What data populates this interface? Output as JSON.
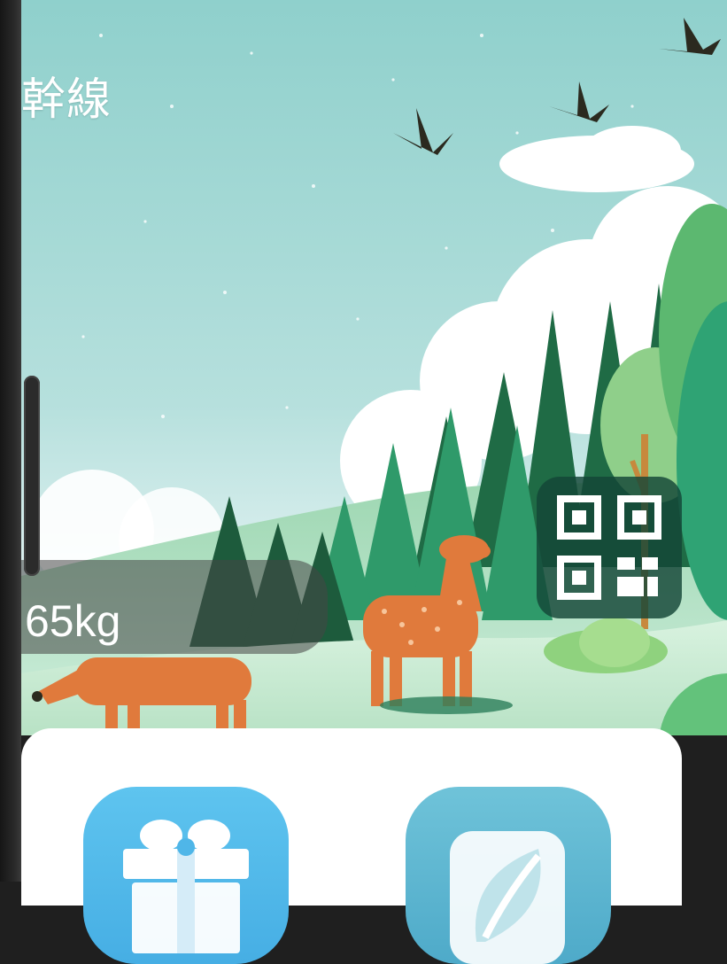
{
  "header": {
    "route_title": "幹線"
  },
  "carbon": {
    "value": "65kg"
  },
  "actions": {
    "qr_icon": "qr-code-icon",
    "gift_icon": "gift-icon",
    "leaf_icon": "leaf-icon"
  },
  "colors": {
    "sky_top": "#8fd0cc",
    "sky_bottom": "#e9f5f5",
    "forest_dark": "#1f6b45",
    "forest_mid": "#2f9a6a",
    "deer": "#e07a3c",
    "qr_bg": "#144637",
    "gift_tile": "#4fb6e8",
    "leaf_tile": "#5bb6cf"
  }
}
